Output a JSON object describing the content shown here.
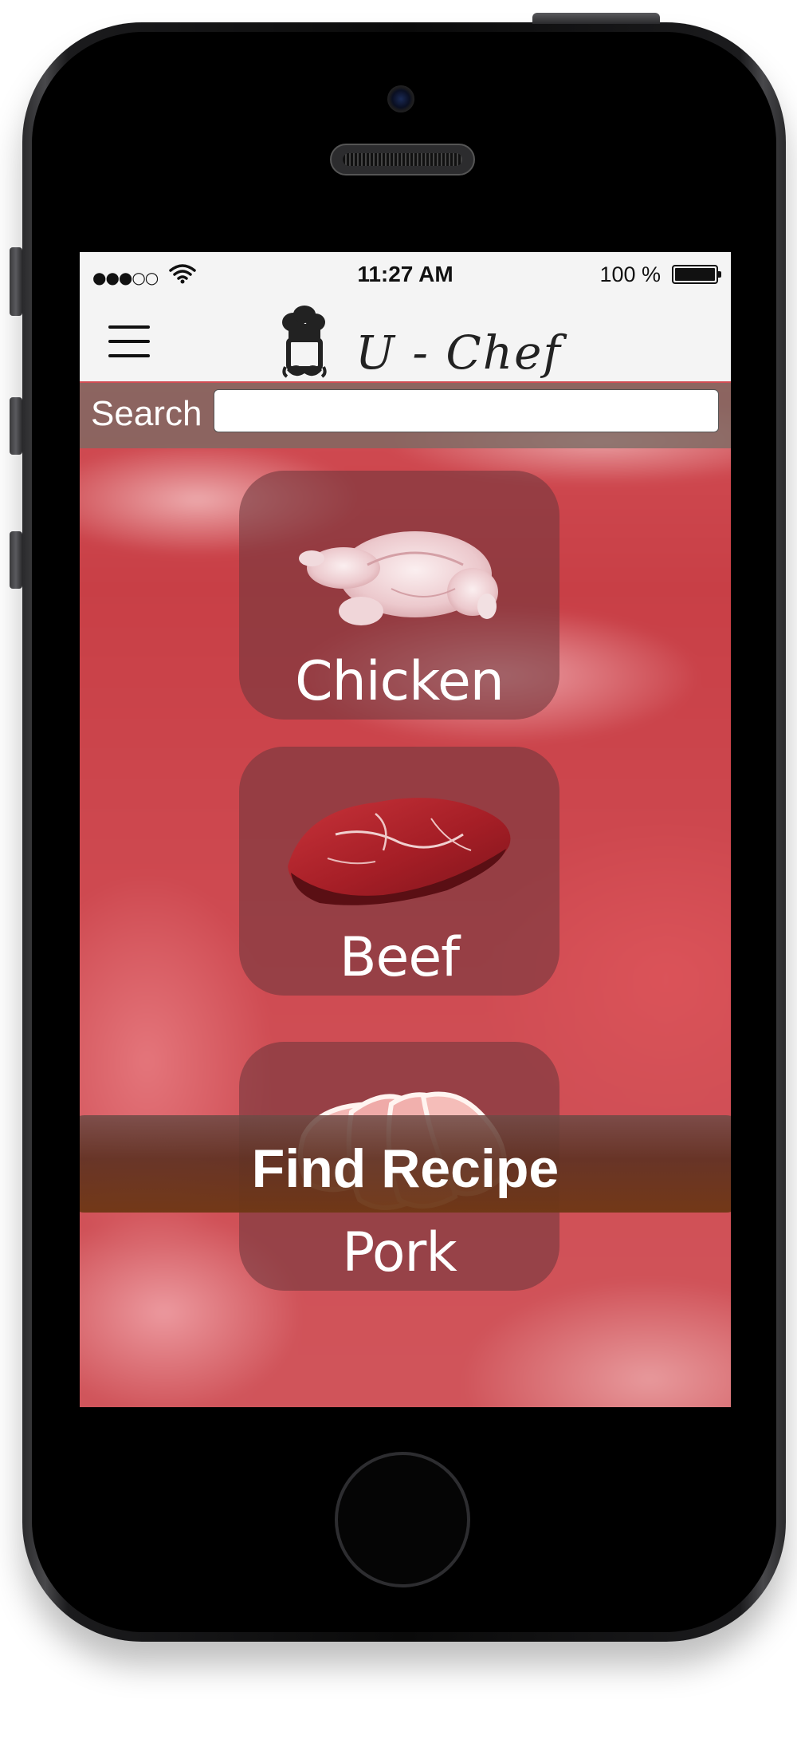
{
  "status_bar": {
    "signal": "●●●○○",
    "time": "11:27 AM",
    "battery_text": "100 %"
  },
  "nav": {
    "menu_icon": "hamburger-icon",
    "logo_text": "U - Chef",
    "logo_icon": "chef-hat-icon"
  },
  "search": {
    "label": "Search",
    "value": "",
    "placeholder": ""
  },
  "categories": [
    {
      "label": "Chicken",
      "icon": "chicken-icon"
    },
    {
      "label": "Beef",
      "icon": "beef-icon"
    },
    {
      "label": "Pork",
      "icon": "pork-icon"
    }
  ],
  "find_button": {
    "label": "Find Recipe"
  },
  "colors": {
    "background_meat": "#c7383d",
    "bar_background": "#f4f4f4",
    "tile_overlay": "#6e373c",
    "button_brown": "#6e3714"
  }
}
